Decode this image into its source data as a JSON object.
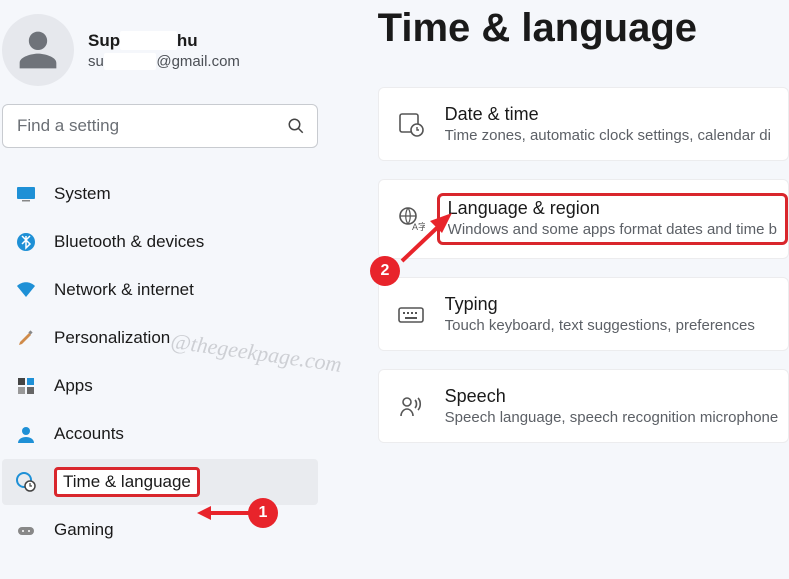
{
  "profile": {
    "name_prefix": "Sup",
    "name_suffix": "hu",
    "email_prefix": "su",
    "email_suffix": "@gmail.com"
  },
  "search": {
    "placeholder": "Find a setting"
  },
  "nav": {
    "system": "System",
    "bluetooth": "Bluetooth & devices",
    "network": "Network & internet",
    "personalization": "Personalization",
    "apps": "Apps",
    "accounts": "Accounts",
    "time": "Time & language",
    "gaming": "Gaming"
  },
  "page": {
    "title": "Time & language"
  },
  "cards": {
    "datetime": {
      "title": "Date & time",
      "sub": "Time zones, automatic clock settings, calendar di"
    },
    "language": {
      "title": "Language & region",
      "sub": "Windows and some apps format dates and time b"
    },
    "typing": {
      "title": "Typing",
      "sub": "Touch keyboard, text suggestions, preferences"
    },
    "speech": {
      "title": "Speech",
      "sub": "Speech language, speech recognition microphone"
    }
  },
  "annotations": {
    "badge1": "1",
    "badge2": "2"
  },
  "watermark": "@thegeekpage.com"
}
